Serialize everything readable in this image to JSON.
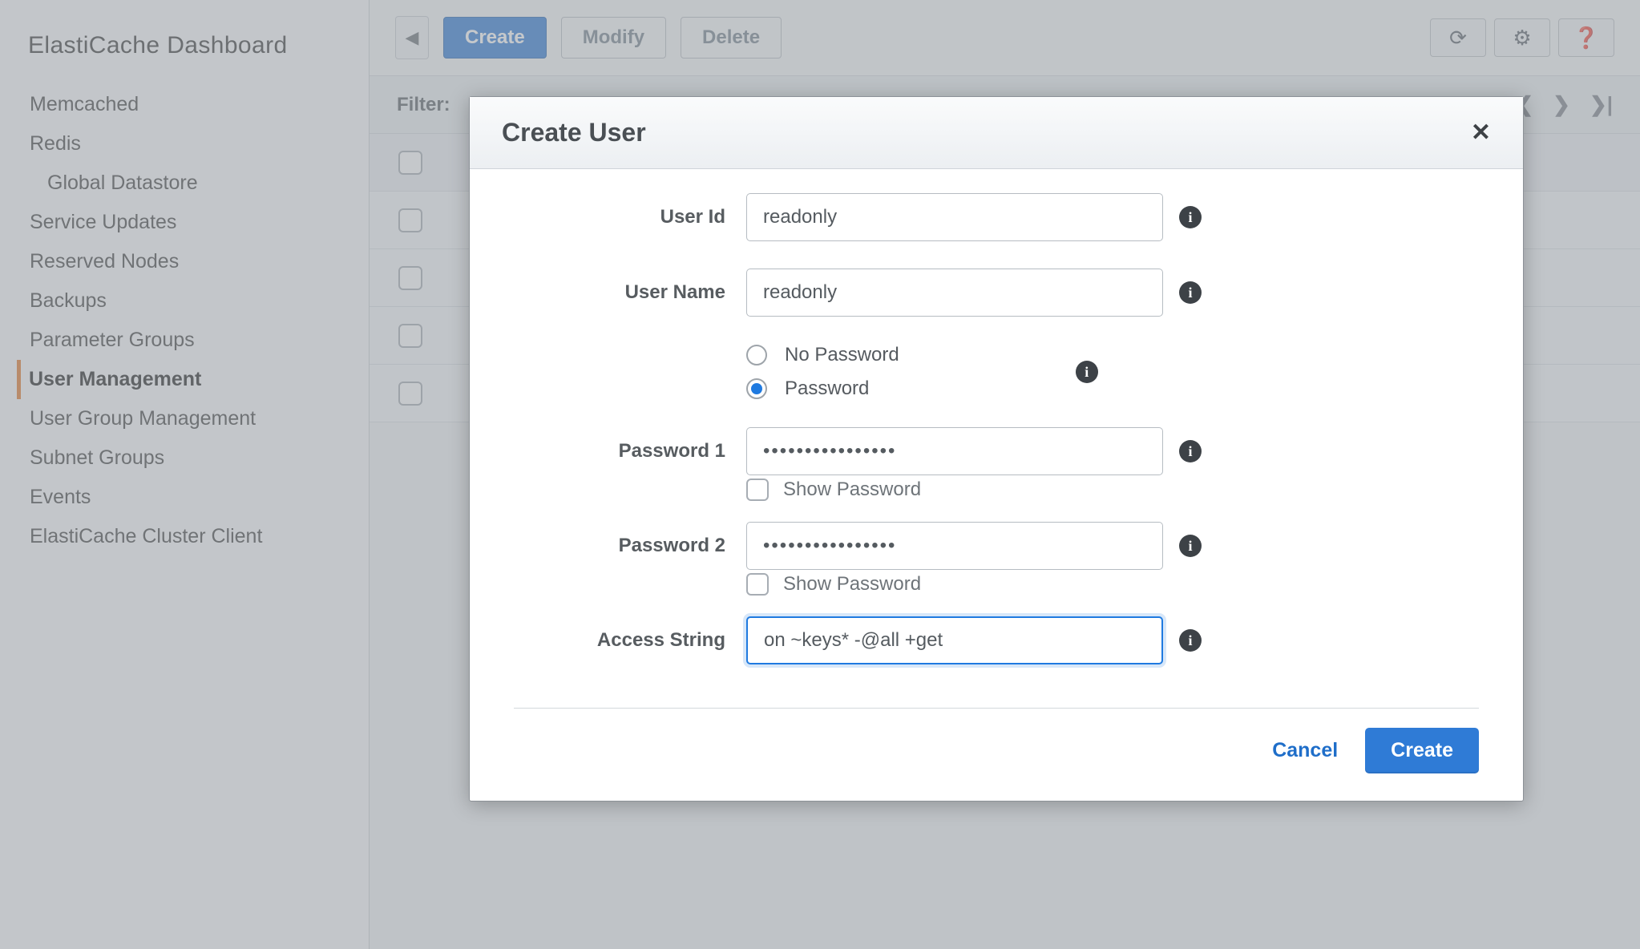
{
  "sidebar": {
    "title": "ElastiCache Dashboard",
    "items": [
      {
        "label": "Memcached"
      },
      {
        "label": "Redis"
      },
      {
        "label": "Global Datastore",
        "sub": true
      },
      {
        "label": "Service Updates"
      },
      {
        "label": "Reserved Nodes"
      },
      {
        "label": "Backups"
      },
      {
        "label": "Parameter Groups"
      },
      {
        "label": "User Management",
        "active": true
      },
      {
        "label": "User Group Management"
      },
      {
        "label": "Subnet Groups"
      },
      {
        "label": "Events"
      },
      {
        "label": "ElastiCache Cluster Client"
      }
    ]
  },
  "toolbar": {
    "create": "Create",
    "modify": "Modify",
    "delete": "Delete"
  },
  "filter_label": "Filter:",
  "modal": {
    "title": "Create User",
    "fields": {
      "user_id": {
        "label": "User Id",
        "value": "readonly"
      },
      "user_name": {
        "label": "User Name",
        "value": "readonly"
      },
      "auth": {
        "no_password": "No Password",
        "password": "Password",
        "selected": "password"
      },
      "password1": {
        "label": "Password 1",
        "value": "••••••••••••••••",
        "mask": true
      },
      "show_password1": "Show Password",
      "password2": {
        "label": "Password 2",
        "value": "••••••••••••••••",
        "mask": true
      },
      "show_password2": "Show Password",
      "access_string": {
        "label": "Access String",
        "value": "on ~keys* -@all +get",
        "focused": true
      }
    },
    "buttons": {
      "cancel": "Cancel",
      "create": "Create"
    }
  }
}
